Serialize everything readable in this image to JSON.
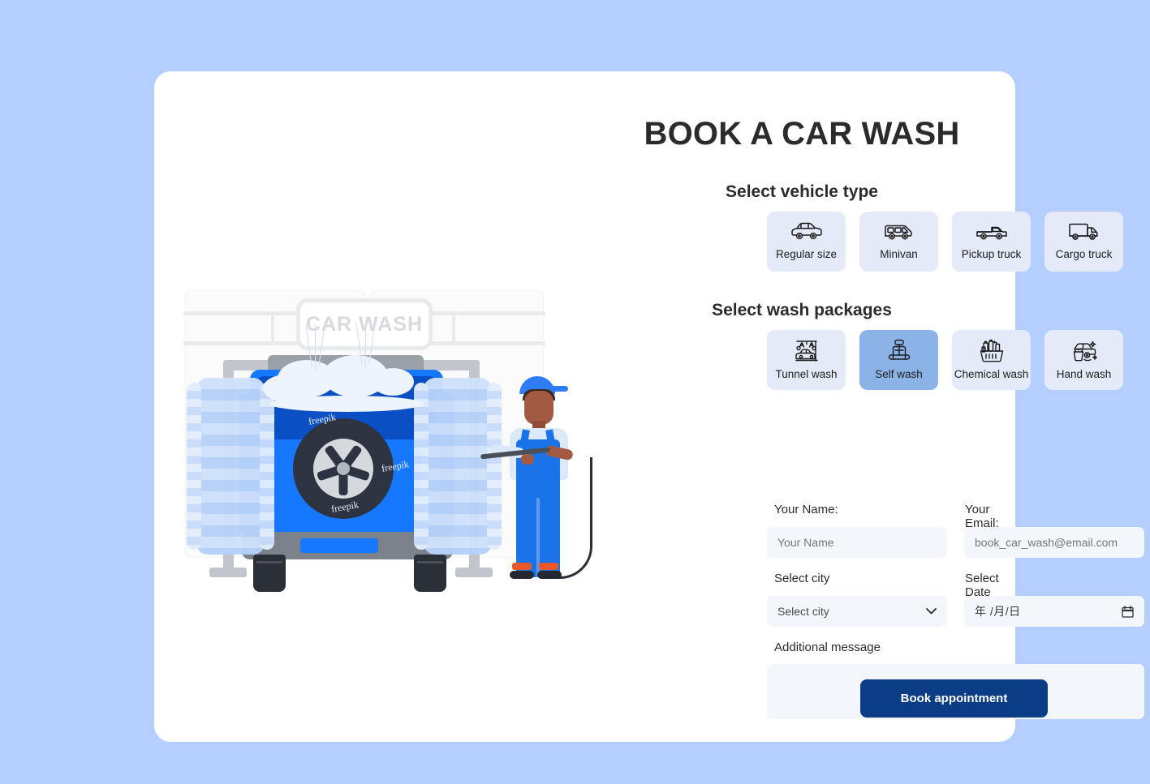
{
  "theme": {
    "page_background": "#b3ceff",
    "card_background": "#ffffff",
    "chip_background": "#e4eaf8",
    "chip_selected_background": "#8cb3e8",
    "input_background": "#f3f6fb",
    "primary_button": "#0a3d86",
    "heading_color": "#2b2b2b"
  },
  "illustration": {
    "sign_text": "CAR WASH",
    "watermark": "freepik"
  },
  "form": {
    "title": "BOOK A CAR WASH",
    "vehicle_section": {
      "heading": "Select vehicle type",
      "options": [
        {
          "label": "Regular size",
          "icon": "car-icon",
          "selected": false
        },
        {
          "label": "Minivan",
          "icon": "minivan-icon",
          "selected": false
        },
        {
          "label": "Pickup truck",
          "icon": "pickup-truck-icon",
          "selected": false
        },
        {
          "label": "Cargo truck",
          "icon": "cargo-truck-icon",
          "selected": false
        }
      ]
    },
    "package_section": {
      "heading": "Select wash packages",
      "options": [
        {
          "label": "Tunnel wash",
          "icon": "tunnel-wash-icon",
          "selected": false
        },
        {
          "label": "Self wash",
          "icon": "car-seat-icon",
          "selected": true
        },
        {
          "label": "Chemical wash",
          "icon": "spray-basket-icon",
          "selected": false
        },
        {
          "label": "Hand wash",
          "icon": "bucket-sponge-icon",
          "selected": false
        }
      ]
    },
    "fields": {
      "name": {
        "label": "Your Name:",
        "placeholder": "Your Name",
        "value": ""
      },
      "email": {
        "label": "Your Email:",
        "placeholder": "book_car_wash@email.com",
        "value": ""
      },
      "city": {
        "label": "Select city",
        "selected": "Select city",
        "options": [
          "Select city"
        ]
      },
      "date": {
        "label": "Select Date",
        "placeholder": "年 /月/日",
        "value": ""
      },
      "message": {
        "label": "Additional message",
        "placeholder": "",
        "value": ""
      }
    },
    "submit_label": "Book appointment"
  }
}
